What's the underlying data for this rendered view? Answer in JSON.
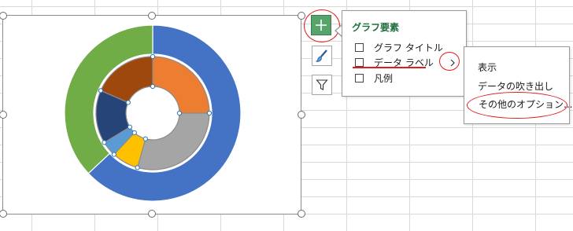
{
  "chart_data": {
    "type": "donut",
    "outer_ring": {
      "values": [
        63,
        37
      ],
      "colors": [
        "#4472c4",
        "#70ad47"
      ]
    },
    "inner_ring": {
      "values": [
        23,
        27,
        7,
        4,
        14,
        17
      ],
      "colors": [
        "#ed7d31",
        "#a5a5a5",
        "#ffc000",
        "#5b9bd5",
        "#264478",
        "#9e480e"
      ]
    }
  },
  "elements_panel": {
    "title": "グラフ要素",
    "options": [
      {
        "label": "グラフ タイトル",
        "checked": false
      },
      {
        "label": "データ ラベル",
        "checked": false
      },
      {
        "label": "凡例",
        "checked": false
      }
    ]
  },
  "data_label_menu": {
    "items": [
      "表示",
      "データの吹き出し",
      "その他のオプション..."
    ]
  },
  "icons": {
    "add": "plus-icon",
    "style": "brush-icon",
    "filter": "funnel-icon",
    "submenu": "chevron-right-icon"
  },
  "colors": {
    "highlight": "#e01c1c",
    "panel_title": "#1e6e3c",
    "add_button": "#56a46a"
  }
}
